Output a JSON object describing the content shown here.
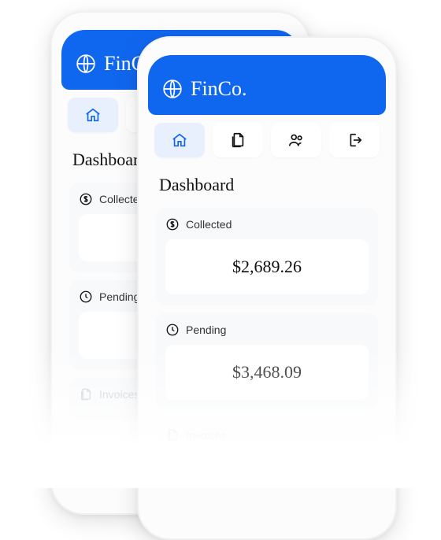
{
  "brand": {
    "name": "FinCo."
  },
  "nav": {
    "items": [
      {
        "name": "home",
        "active": true
      },
      {
        "name": "documents",
        "active": false
      },
      {
        "name": "users",
        "active": false
      },
      {
        "name": "logout",
        "active": false
      }
    ]
  },
  "page": {
    "title": "Dashboard"
  },
  "cards": {
    "collected": {
      "label": "Collected",
      "value": "$2,689.26"
    },
    "pending": {
      "label": "Pending",
      "value": "$3,468.09"
    },
    "invoices": {
      "label": "Invoices"
    }
  }
}
